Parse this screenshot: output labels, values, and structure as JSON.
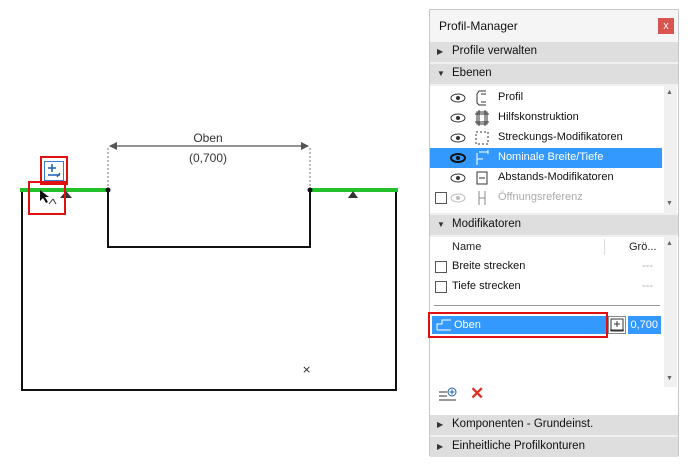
{
  "canvas": {
    "dimension_name": "Oben",
    "dimension_value": "(0,700)",
    "colors": {
      "edge_highlight": "#22c02a",
      "shape_stroke": "#111111",
      "highlight_box": "#e01010"
    }
  },
  "panel": {
    "title": "Profil-Manager",
    "close_glyph": "x",
    "sections": {
      "profile_verwalten": "Profile verwalten",
      "ebenen": "Ebenen",
      "modifikatoren": "Modifikatoren",
      "komponenten": "Komponenten - Grundeinst.",
      "profilkonturen": "Einheitliche Profilkonturen"
    },
    "layers": [
      {
        "label": "Profil",
        "icon": "profile-icon",
        "visible": true
      },
      {
        "label": "Hilfskonstruktion",
        "icon": "grid-icon",
        "visible": true
      },
      {
        "label": "Streckungs-Modifikatoren",
        "icon": "stretch-icon",
        "visible": true
      },
      {
        "label": "Nominale Breite/Tiefe",
        "icon": "nominal-dim-icon",
        "visible": true,
        "selected": true
      },
      {
        "label": "Abstands-Modifikatoren",
        "icon": "offset-icon",
        "visible": true
      },
      {
        "label": "Öffnungsreferenz",
        "icon": "opening-icon",
        "visible": false,
        "disabled": true
      }
    ],
    "modifier_columns": {
      "name": "Name",
      "size": "Grö..."
    },
    "modifiers": [
      {
        "label": "Breite strecken",
        "value": "---"
      },
      {
        "label": "Tiefe strecken",
        "value": "---"
      }
    ],
    "selected_modifier": {
      "label": "Oben",
      "value": "0,700"
    },
    "accent": "#3399ff"
  }
}
